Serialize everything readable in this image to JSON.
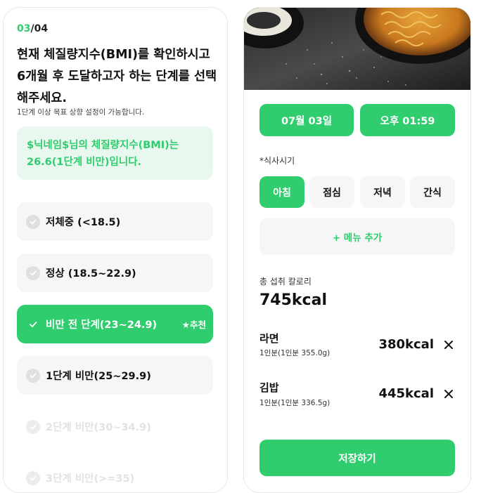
{
  "colors": {
    "accent": "#2fcd6e",
    "accent_light": "#e9f8ee",
    "option_bg": "#f6f6f6"
  },
  "left": {
    "step_current": "03",
    "step_total": "/04",
    "question": "현재 체질량지수(BMI)를 확인하시고 6개월 후 도달하고자 하는 단계를 선택해주세요.",
    "hint": "1단계 이상 목표 상향 설정이 가능합니다.",
    "bmi_info": "$닉네임$님의 체질량지수(BMI)는 26.6(1단계 비만)입니다.",
    "options": [
      {
        "label": "저체중 (<18.5)",
        "state": "enabled"
      },
      {
        "label": "정상 (18.5~22.9)",
        "state": "enabled"
      },
      {
        "label": "비만 전 단계(23~24.9)",
        "state": "selected",
        "badge": "추천"
      },
      {
        "label": "1단계 비만(25~29.9)",
        "state": "enabled"
      },
      {
        "label": "2단계 비만(30~34.9)",
        "state": "disabled"
      },
      {
        "label": "3단계 비만(>=35)",
        "state": "disabled"
      }
    ]
  },
  "right": {
    "date": "07월 03일",
    "time": "오후 01:59",
    "meal_time_label": "*식사시기",
    "meal_tabs": [
      {
        "label": "아침",
        "active": true
      },
      {
        "label": "점심",
        "active": false
      },
      {
        "label": "저녁",
        "active": false
      },
      {
        "label": "간식",
        "active": false
      }
    ],
    "add_menu_label": "+ 메뉴 추가",
    "total_label": "총 섭취 칼로리",
    "total_value": "745kcal",
    "foods": [
      {
        "name": "라면",
        "serving": "1인분(1인분 355.0g)",
        "kcal": "380kcal"
      },
      {
        "name": "김밥",
        "serving": "1인분(1인분 336.5g)",
        "kcal": "445kcal"
      }
    ],
    "save_label": "저장하기"
  }
}
